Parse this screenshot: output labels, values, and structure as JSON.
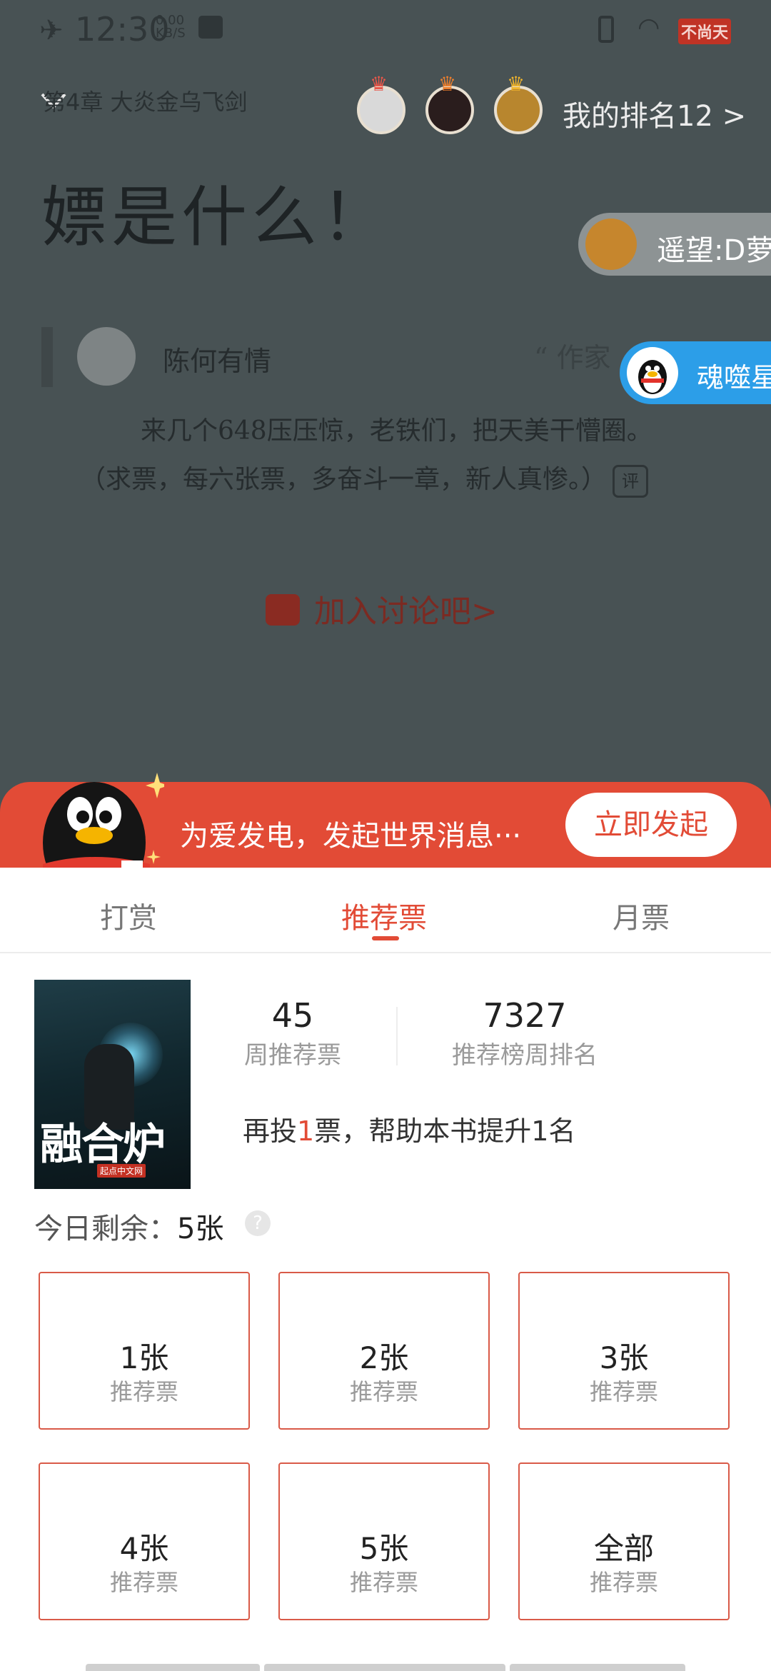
{
  "status_bar": {
    "time": "12:30",
    "speed_value": "0.00",
    "speed_unit": "KB/S",
    "brand_label": "不尚天"
  },
  "reader": {
    "chapter_name": "第4章 大炎金乌飞剑",
    "rank_text": "我的排名12 >",
    "chapter_title": "嫖是什么！",
    "floating_1": "遥望:D萝",
    "floating_2": "魂噬星",
    "comment": {
      "user": "陈何有情",
      "author_tag": "“ 作家",
      "line1": "来几个648压压惊，老铁们，把天美干懵圈。",
      "line2": "（求票，每六张票，多奋斗一章，新人真惨。）",
      "ping_icon_label": "评"
    },
    "join_text": "加入讨论吧>"
  },
  "promo": {
    "text": "为爱发电，发起世界消息···",
    "button": "立即发起"
  },
  "sheet": {
    "tabs": [
      {
        "label": "打赏",
        "active": false
      },
      {
        "label": "推荐票",
        "active": true
      },
      {
        "label": "月票",
        "active": false
      }
    ],
    "book": {
      "cover_title": "融合炉",
      "cover_badge": "起点中文网"
    },
    "stats": [
      {
        "value": "45",
        "label": "周推荐票"
      },
      {
        "value": "7327",
        "label": "推荐榜周排名"
      }
    ],
    "help": {
      "prefix": "再投",
      "highlight": "1",
      "suffix": "票，帮助本书提升1名"
    },
    "remaining_label": "今日剩余：",
    "remaining_value": "5张",
    "help_icon": "?",
    "vote_options": [
      {
        "amount": "1张",
        "sub": "推荐票"
      },
      {
        "amount": "2张",
        "sub": "推荐票"
      },
      {
        "amount": "3张",
        "sub": "推荐票"
      },
      {
        "amount": "4张",
        "sub": "推荐票"
      },
      {
        "amount": "5张",
        "sub": "推荐票"
      },
      {
        "amount": "全部",
        "sub": "推荐票"
      }
    ]
  },
  "colors": {
    "accent": "#e24b36",
    "overlay_bg": "#485254",
    "qq_blue": "#2c9ee8",
    "muted_text": "#9a9a9a"
  },
  "icons": [
    "airplane-icon",
    "note-icon",
    "vibrate-icon",
    "wifi-icon",
    "chevron-down-icon",
    "crown-icon",
    "comment-icon",
    "help-icon",
    "qq-penguin-icon",
    "sparkle-icon"
  ]
}
